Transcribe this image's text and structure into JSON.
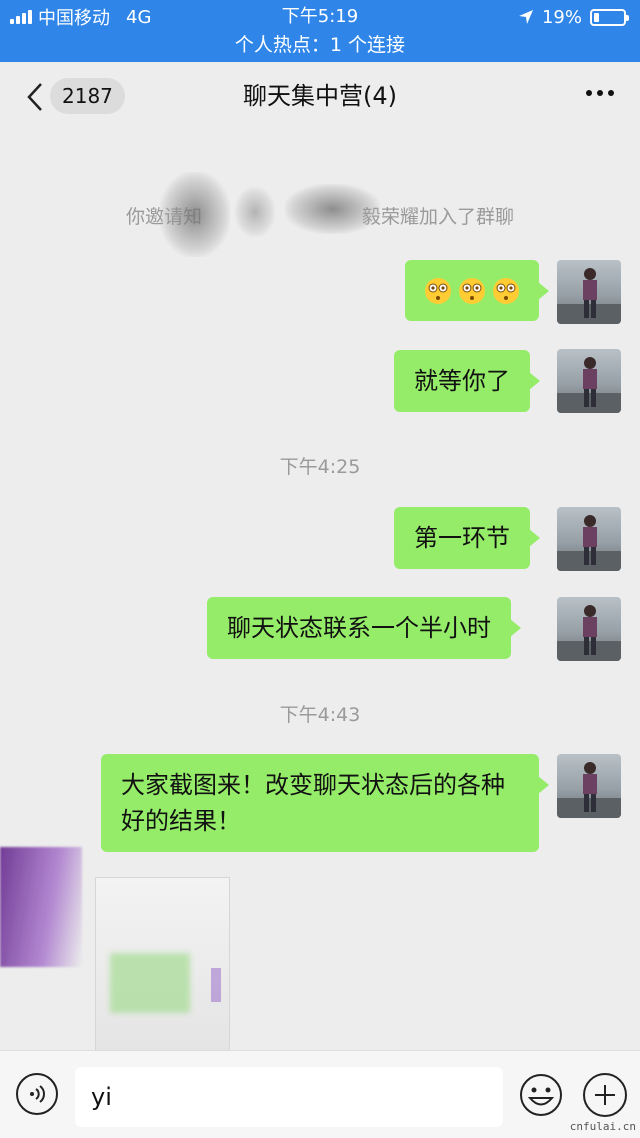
{
  "status_bar": {
    "carrier": "中国移动",
    "network": "4G",
    "time": "下午5:19",
    "battery": "19%",
    "battery_level": 0.19,
    "hotspot": "个人热点：1 个连接"
  },
  "nav": {
    "unread_count": "2187",
    "title": "聊天集中营(4)"
  },
  "messages": {
    "system_partial": "你邀请知",
    "system_suffix": "毅荣耀加入了群聊",
    "msg1_emoji": [
      "flushed-face-emoji",
      "flushed-face-emoji",
      "flushed-face-emoji"
    ],
    "msg2": "就等你了",
    "time2": "下午4:25",
    "msg3": "第一环节",
    "msg4": "聊天状态联系一个半小时",
    "time3": "下午4:43",
    "msg5": "大家截图来！改变聊天状态后的各种好的结果！"
  },
  "input": {
    "value": "yi"
  },
  "watermark": "cnfulai.cn",
  "colors": {
    "status_bar_bg": "#2f86e8",
    "bubble_green": "#95ec69",
    "chat_bg": "#ededed"
  }
}
